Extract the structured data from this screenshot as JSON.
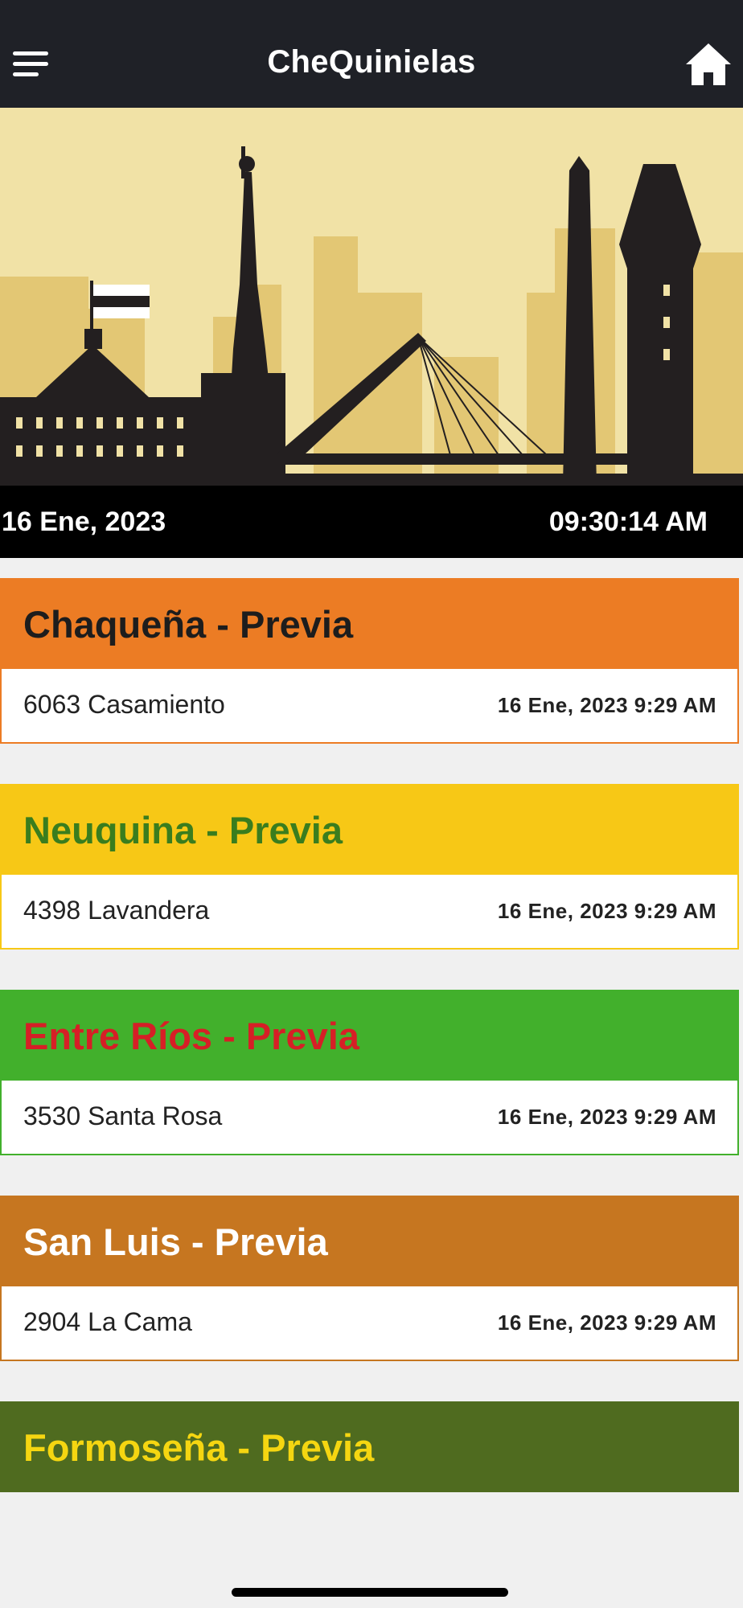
{
  "header": {
    "title": "CheQuinielas",
    "menu_icon": "hamburger-menu-icon",
    "home_icon": "home-icon"
  },
  "datetime": {
    "date": "16 Ene, 2023",
    "time": "09:30:14 AM"
  },
  "colors": {
    "topbar": "#1f2127",
    "page_bg": "#f0f0f0",
    "hero_sky": "#f1e2a6",
    "silhouette": "#231f20"
  },
  "cards": [
    {
      "title": "Chaqueña - Previa",
      "value": "6063 Casamiento",
      "timestamp": "16 Ene, 2023 9:29 AM",
      "bg": "#ec7c24",
      "title_color": "#1d1d1d"
    },
    {
      "title": "Neuquina - Previa",
      "value": "4398 Lavandera",
      "timestamp": "16 Ene, 2023 9:29 AM",
      "bg": "#f7c816",
      "title_color": "#3a7d1e"
    },
    {
      "title": "Entre Ríos - Previa",
      "value": "3530 Santa Rosa",
      "timestamp": "16 Ene, 2023 9:29 AM",
      "bg": "#42b02c",
      "title_color": "#d61f26"
    },
    {
      "title": "San Luis - Previa",
      "value": "2904 La Cama",
      "timestamp": "16 Ene, 2023 9:29 AM",
      "bg": "#c67620",
      "title_color": "#ffffff"
    },
    {
      "title": "Formoseña - Previa",
      "value": "",
      "timestamp": "",
      "bg": "#4f6b1f",
      "title_color": "#f5d611"
    }
  ]
}
